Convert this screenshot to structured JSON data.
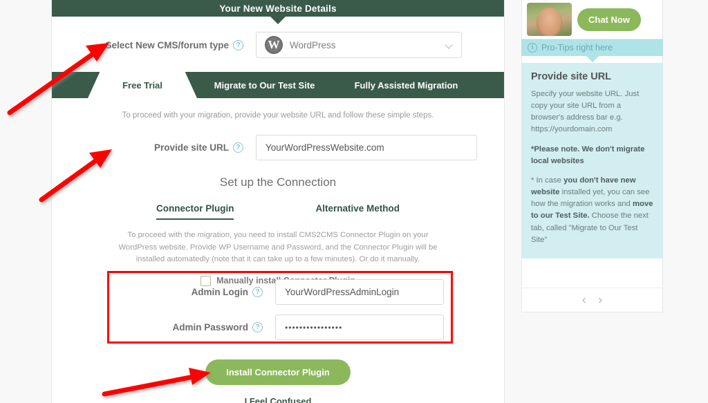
{
  "panel": {
    "header_title": "Your New Website Details",
    "cms": {
      "label": "Select New CMS/forum type",
      "help": "?",
      "selected": "WordPress",
      "logo_glyph": "W"
    },
    "tabs": [
      {
        "label": "Free Trial",
        "active": true
      },
      {
        "label": "Migrate to Our Test Site",
        "active": false
      },
      {
        "label": "Fully Assisted Migration",
        "active": false
      }
    ],
    "intro": "To proceed with your migration, provide your website URL and follow these simple steps.",
    "site_url": {
      "label": "Provide site URL",
      "help": "?",
      "value": "YourWordPressWebsite.com"
    },
    "connection": {
      "title": "Set up the Connection",
      "subtabs": [
        {
          "label": "Connector Plugin",
          "active": true
        },
        {
          "label": "Alternative Method",
          "active": false
        }
      ],
      "description": "To proceed with the migration, you need to install CMS2CMS Connector Plugin on your WordPress website. Provide WP Username and Password, and the Connector Plugin will be installed automatedly (note that it can take up to a few minutes). Or do it manually.",
      "manual_checkbox_label": "Manually install Connector Plugin",
      "manual_checked": false
    },
    "credentials": {
      "login": {
        "label": "Admin Login",
        "help": "?",
        "value": "YourWordPressAdminLogin"
      },
      "password": {
        "label": "Admin Password",
        "help": "?",
        "value": "••••••••••••••••"
      }
    },
    "actions": {
      "primary_label": "Install Connector Plugin",
      "secondary_label": "I Feel Confused"
    }
  },
  "sidebar": {
    "chat_button_label": "Chat Now",
    "tips_bar_label": "Pro-Tips right here",
    "tips_bar_icon": "i",
    "tips_title": "Provide site URL",
    "tips_paragraph_1": "Specify your website URL. Just copy your site URL from a browser's address bar e.g. https://yourdomain.com",
    "tips_paragraph_2_bold": "*Please note. We don't migrate local websites",
    "tips_paragraph_3_a": "* In case ",
    "tips_paragraph_3_b": "you don't have new website",
    "tips_paragraph_3_c": " installed yet, you can see how the migration works and ",
    "tips_paragraph_3_d": "move to our Test Site.",
    "tips_paragraph_3_e": " Choose the next tab, called \"Migrate to Our Test Site\"",
    "nav_prev": "‹",
    "nav_next": "›"
  },
  "colors": {
    "header_green": "#3a5a4a",
    "button_green": "#8cb85c",
    "tip_teal": "#aee3e8",
    "tip_body_teal": "#d2eef0",
    "annotation_red": "#ff0000",
    "help_icon_blue": "#7fc6d6"
  }
}
